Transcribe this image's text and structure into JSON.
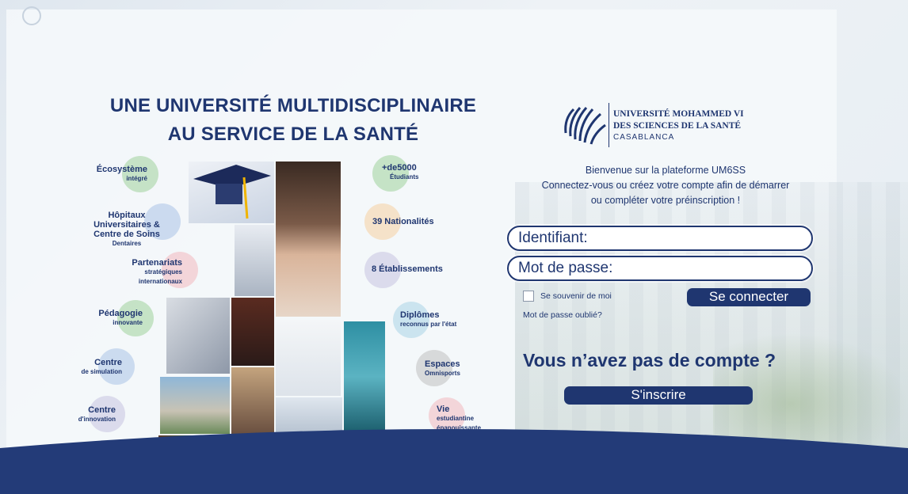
{
  "headline": {
    "line1": "UNE UNIVERSITÉ MULTIDISCIPLINAIRE",
    "line2": "AU SERVICE DE LA SANTÉ"
  },
  "left_features": [
    {
      "main": "Écosystème",
      "sub": "intégré",
      "color": "#9fd19a"
    },
    {
      "main": "Hôpitaux Universitaires & Centre de Soins",
      "sub": "Dentaires",
      "color": "#a9c3e6"
    },
    {
      "main": "Partenariats",
      "sub": "stratégiques internationaux",
      "color": "#f3b8be"
    },
    {
      "main": "Pédagogie",
      "sub": "innovante",
      "color": "#9fd19a"
    },
    {
      "main": "Centre",
      "sub": "de simulation",
      "color": "#a9c3e6"
    },
    {
      "main": "Centre",
      "sub": "d'innovation",
      "color": "#c6c2e0"
    }
  ],
  "right_features": [
    {
      "main": "+de5000",
      "sub": "Étudiants",
      "color": "#9fd19a"
    },
    {
      "main": "39 Nationalités",
      "sub": "",
      "color": "#f6cfa0"
    },
    {
      "main": "8 Établissements",
      "sub": "",
      "color": "#c6c2e0"
    },
    {
      "main": "Diplômes",
      "sub": "reconnus par l'état",
      "color": "#a9d4e6"
    },
    {
      "main": "Espaces",
      "sub": "Omnisports",
      "color": "#bfbfbf"
    },
    {
      "main": "Vie",
      "sub": "estudiantine épanouissante",
      "color": "#f3b8be"
    }
  ],
  "logo": {
    "line1": "UNIVERSITÉ MOHAMMED VI",
    "line2": "DES SCIENCES DE LA SANTÉ",
    "line3": "CASABLANCA"
  },
  "welcome": {
    "line1": "Bienvenue sur la plateforme UM6SS",
    "line2": "Connectez-vous ou créez votre compte afin de démarrer",
    "line3": "ou compléter votre préinscription !"
  },
  "login": {
    "username_label": "Identifiant:",
    "password_label": "Mot de passe:",
    "remember_label": "Se souvenir de moi",
    "connect_button": "Se connecter",
    "forgot_link": "Mot de passe oublié?"
  },
  "signup": {
    "question": "Vous n’avez pas de compte ?",
    "button": "S'inscrire"
  },
  "colors": {
    "brand_navy": "#1f3670",
    "wave": "#233b78"
  }
}
